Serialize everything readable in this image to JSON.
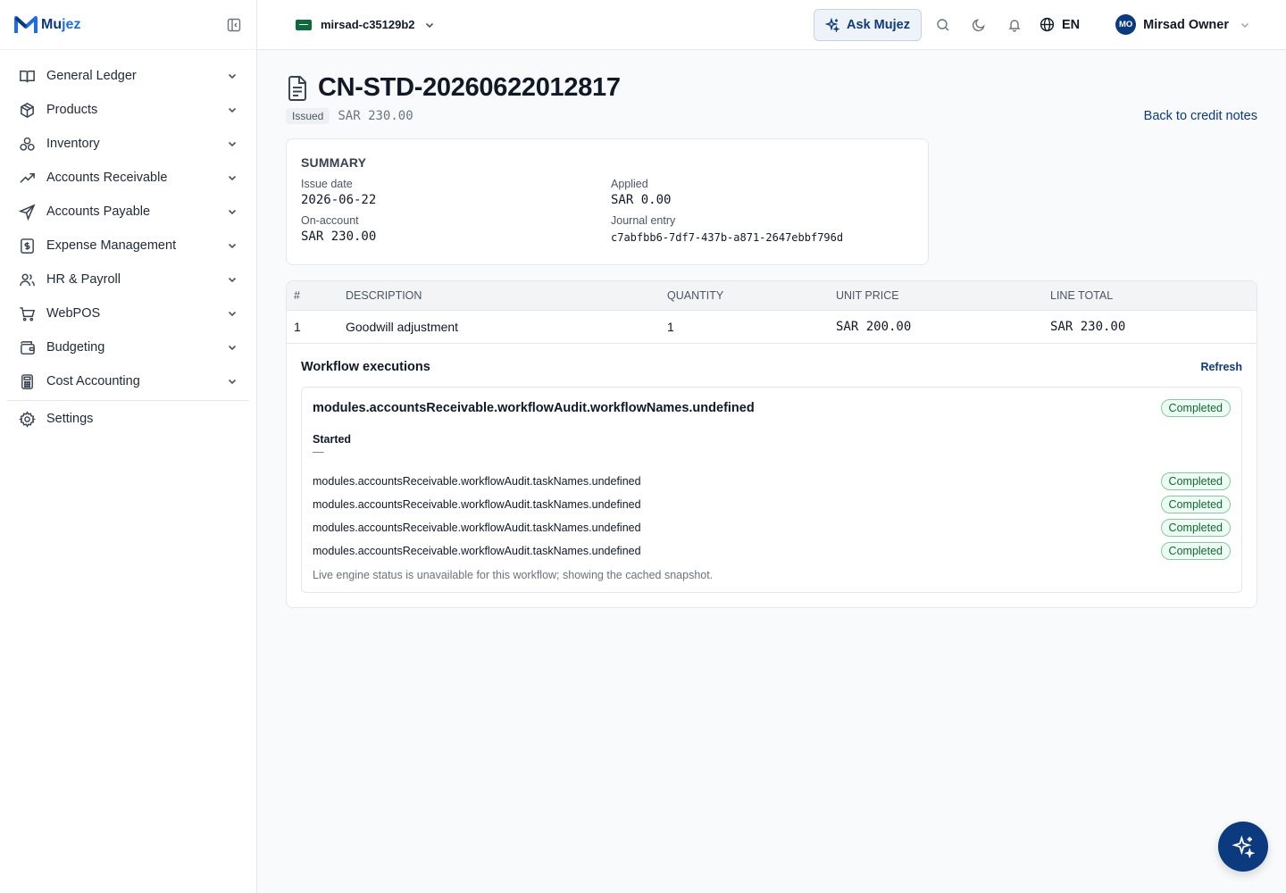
{
  "brand": {
    "name_part1": "Mu",
    "name_part2": "jez"
  },
  "sidebar": {
    "items": [
      {
        "label": "General Ledger",
        "icon": "book-open-icon"
      },
      {
        "label": "Products",
        "icon": "package-icon"
      },
      {
        "label": "Inventory",
        "icon": "boxes-icon"
      },
      {
        "label": "Accounts Receivable",
        "icon": "trending-up-icon"
      },
      {
        "label": "Accounts Payable",
        "icon": "send-icon"
      },
      {
        "label": "Expense Management",
        "icon": "receipt-icon"
      },
      {
        "label": "HR & Payroll",
        "icon": "users-icon"
      },
      {
        "label": "WebPOS",
        "icon": "cart-icon"
      },
      {
        "label": "Budgeting",
        "icon": "wallet-icon"
      },
      {
        "label": "Cost Accounting",
        "icon": "calculator-icon"
      }
    ],
    "settings_label": "Settings"
  },
  "topbar": {
    "tenant": "mirsad-c35129b2",
    "ask_label": "Ask Mujez",
    "language": "EN",
    "user_initials": "MO",
    "user_name": "Mirsad Owner"
  },
  "header": {
    "title": "CN-STD-20260622012817",
    "status": "Issued",
    "amount": "SAR 230.00",
    "back_link": "Back to credit notes"
  },
  "summary": {
    "heading": "Summary",
    "fields": [
      {
        "label": "Issue date",
        "value": "2026-06-22"
      },
      {
        "label": "Applied",
        "value": "SAR 0.00"
      },
      {
        "label": "On-account",
        "value": "SAR 230.00"
      },
      {
        "label": "Journal entry",
        "value": "c7abfbb6-7df7-437b-a871-2647ebbf796d"
      }
    ]
  },
  "lines": {
    "headers": [
      "#",
      "Description",
      "Quantity",
      "Unit price",
      "Line total"
    ],
    "rows": [
      {
        "no": "1",
        "description": "Goodwill adjustment",
        "quantity": "1",
        "unit_price": "SAR 200.00",
        "line_total": "SAR 230.00"
      }
    ]
  },
  "workflow": {
    "title": "Workflow executions",
    "refresh_label": "Refresh",
    "name": "modules.accountsReceivable.workflowAudit.workflowNames.undefined",
    "status": "Completed",
    "started_label": "Started",
    "started_value": "—",
    "tasks": [
      {
        "name": "modules.accountsReceivable.workflowAudit.taskNames.undefined",
        "status": "Completed"
      },
      {
        "name": "modules.accountsReceivable.workflowAudit.taskNames.undefined",
        "status": "Completed"
      },
      {
        "name": "modules.accountsReceivable.workflowAudit.taskNames.undefined",
        "status": "Completed"
      },
      {
        "name": "modules.accountsReceivable.workflowAudit.taskNames.undefined",
        "status": "Completed"
      }
    ],
    "note": "Live engine status is unavailable for this workflow; showing the cached snapshot."
  },
  "colors": {
    "brand": "#0b3a7e",
    "success": "#166534",
    "success_bg": "#ecfdf3"
  }
}
